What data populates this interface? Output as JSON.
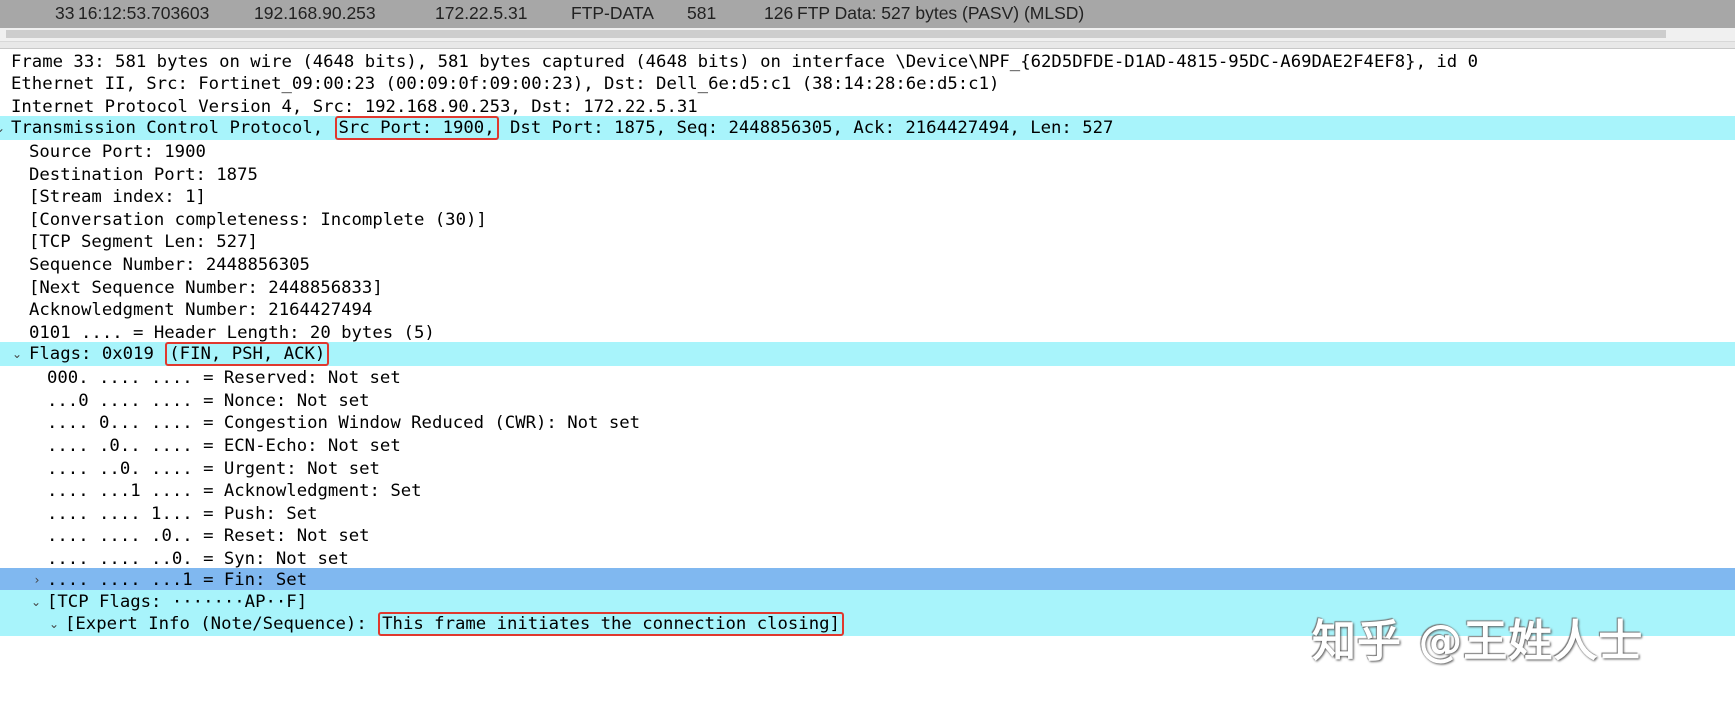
{
  "packet_row": {
    "no": "33",
    "time": "16:12:53.703603",
    "source": "192.168.90.253",
    "destination": "172.22.5.31",
    "protocol": "FTP-DATA",
    "length": "581",
    "info_num": "126",
    "info": "FTP Data: 527 bytes (PASV) (MLSD)"
  },
  "tree": {
    "frame": "Frame 33: 581 bytes on wire (4648 bits), 581 bytes captured (4648 bits) on interface \\Device\\NPF_{62D5DFDE-D1AD-4815-95DC-A69DAE2F4EF8}, id 0",
    "ethernet": "Ethernet II, Src: Fortinet_09:00:23 (00:09:0f:09:00:23), Dst: Dell_6e:d5:c1 (38:14:28:6e:d5:c1)",
    "ipv4": "Internet Protocol Version 4, Src: 192.168.90.253, Dst: 172.22.5.31",
    "tcp": {
      "prefix": "Transmission Control Protocol, ",
      "src_port_box": "Src Port: 1900,",
      "suffix": " Dst Port: 1875, Seq: 2448856305, Ack: 2164427494, Len: 527"
    },
    "tcp_fields": [
      "Source Port: 1900",
      "Destination Port: 1875",
      "[Stream index: 1]",
      "[Conversation completeness: Incomplete (30)]",
      "[TCP Segment Len: 527]",
      "Sequence Number: 2448856305",
      "[Next Sequence Number: 2448856833]",
      "Acknowledgment Number: 2164427494",
      "0101 .... = Header Length: 20 bytes (5)"
    ],
    "flags": {
      "prefix": "Flags: 0x019 ",
      "box": "(FIN, PSH, ACK)"
    },
    "flag_bits": [
      "000. .... .... = Reserved: Not set",
      "...0 .... .... = Nonce: Not set",
      ".... 0... .... = Congestion Window Reduced (CWR): Not set",
      ".... .0.. .... = ECN-Echo: Not set",
      ".... ..0. .... = Urgent: Not set",
      ".... ...1 .... = Acknowledgment: Set",
      ".... .... 1... = Push: Set",
      ".... .... .0.. = Reset: Not set",
      ".... .... ..0. = Syn: Not set",
      ".... .... ...1 = Fin: Set"
    ],
    "tcp_flags_summary": "[TCP Flags: ·······AP··F]",
    "expert_info": {
      "prefix": "[Expert Info (Note/Sequence): ",
      "box": "This frame initiates the connection closing]"
    }
  },
  "watermark": "知乎 @王姓人士",
  "colors": {
    "selected_row": "#a8f4fb",
    "focused_row": "#80b8f0",
    "annotation_box": "#e0382e",
    "packet_row_bg": "#a7a7a7"
  }
}
